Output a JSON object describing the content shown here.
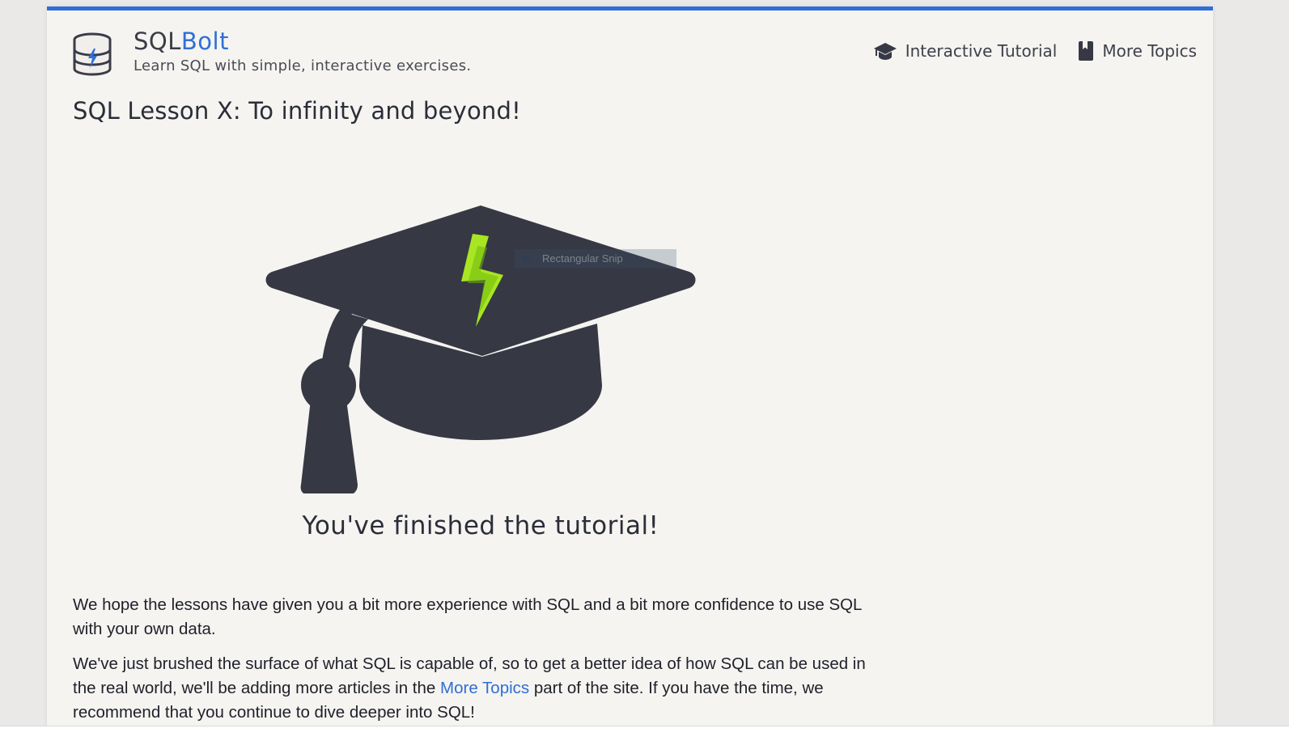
{
  "header": {
    "brand_sql": "SQL",
    "brand_bolt": "Bolt",
    "tagline": "Learn SQL with simple, interactive exercises."
  },
  "nav": {
    "interactive_tutorial": "Interactive Tutorial",
    "more_topics": "More Topics"
  },
  "lesson": {
    "title": "SQL Lesson X: To infinity and beyond!",
    "finished": "You've finished the tutorial!",
    "paragraph1": "We hope the lessons have given you a bit more experience with SQL and a bit more confidence to use SQL with your own data.",
    "paragraph2_before": "We've just brushed the surface of what SQL is capable of, so to get a better idea of how SQL can be used in the real world, we'll be adding more articles in the ",
    "paragraph2_link": "More Topics",
    "paragraph2_after": " part of the site. If you have the time, we recommend that you continue to dive deeper into SQL!"
  },
  "overlay": {
    "snip_label": "Rectangular Snip"
  },
  "colors": {
    "accent": "#2f6fd6",
    "cap": "#363843",
    "bolt_light": "#a8e622",
    "bolt_dark": "#6fb80f"
  }
}
